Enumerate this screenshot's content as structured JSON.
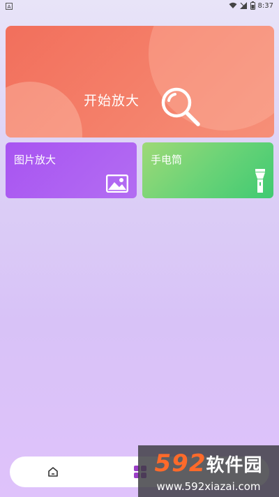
{
  "status_bar": {
    "notification_icon": "A",
    "time": "8:37",
    "icons": [
      "wifi-icon",
      "signal-icon",
      "battery-icon"
    ]
  },
  "main_card": {
    "label": "开始放大",
    "icon": "magnifier-icon",
    "color": "#f26f5c"
  },
  "feature_cards": [
    {
      "label": "图片放大",
      "icon": "image-icon",
      "color": "#a854f1"
    },
    {
      "label": "手电筒",
      "icon": "flashlight-icon",
      "color": "#56cf75"
    }
  ],
  "bottom_nav": {
    "items": [
      {
        "icon": "home-icon"
      },
      {
        "icon": "grid-icon",
        "active": true
      }
    ],
    "accent_color": "#9b3ec7"
  },
  "watermark": {
    "number": "592",
    "name": "软件园",
    "url": "www.592xiazai.com"
  }
}
